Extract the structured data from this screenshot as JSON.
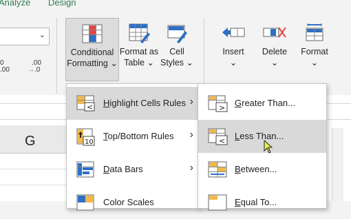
{
  "tabs": {
    "analyze": "Analyze",
    "design": "Design"
  },
  "ribbon": {
    "number_dec_increase": ".0\n.00",
    "number_dec_decrease": ".00\n→.0",
    "conditional_formatting": {
      "line1": "Conditional",
      "line2": "Formatting",
      "caret": "⌄"
    },
    "format_as_table": {
      "line1": "Format as",
      "line2": "Table",
      "caret": "⌄"
    },
    "cell_styles": {
      "line1": "Cell",
      "line2": "Styles",
      "caret": "⌄"
    },
    "insert": {
      "label": "Insert",
      "caret": "⌄"
    },
    "delete": {
      "label": "Delete",
      "caret": "⌄"
    },
    "format": {
      "label": "Format",
      "caret": "⌄"
    }
  },
  "sheet": {
    "column_g": "G"
  },
  "cf_menu": {
    "items": [
      {
        "key": "H",
        "rest": "ighlight Cells Rules",
        "has_submenu": true
      },
      {
        "key": "T",
        "rest": "op/Bottom Rules",
        "has_submenu": true
      },
      {
        "key": "D",
        "rest": "ata Bars",
        "has_submenu": true
      },
      {
        "key": "",
        "rest": "Color Scales",
        "has_submenu": true
      }
    ]
  },
  "hcr_submenu": {
    "items": [
      {
        "key": "G",
        "rest": "reater Than..."
      },
      {
        "key": "L",
        "rest": "ess Than..."
      },
      {
        "key": "B",
        "rest": "etween..."
      },
      {
        "key": "E",
        "rest": "qual To..."
      }
    ]
  },
  "colors": {
    "accent_green": "#2e7d4f",
    "hover_gray": "#d9d9d9",
    "icon_blue": "#2f6fc4",
    "icon_red": "#e04848"
  }
}
